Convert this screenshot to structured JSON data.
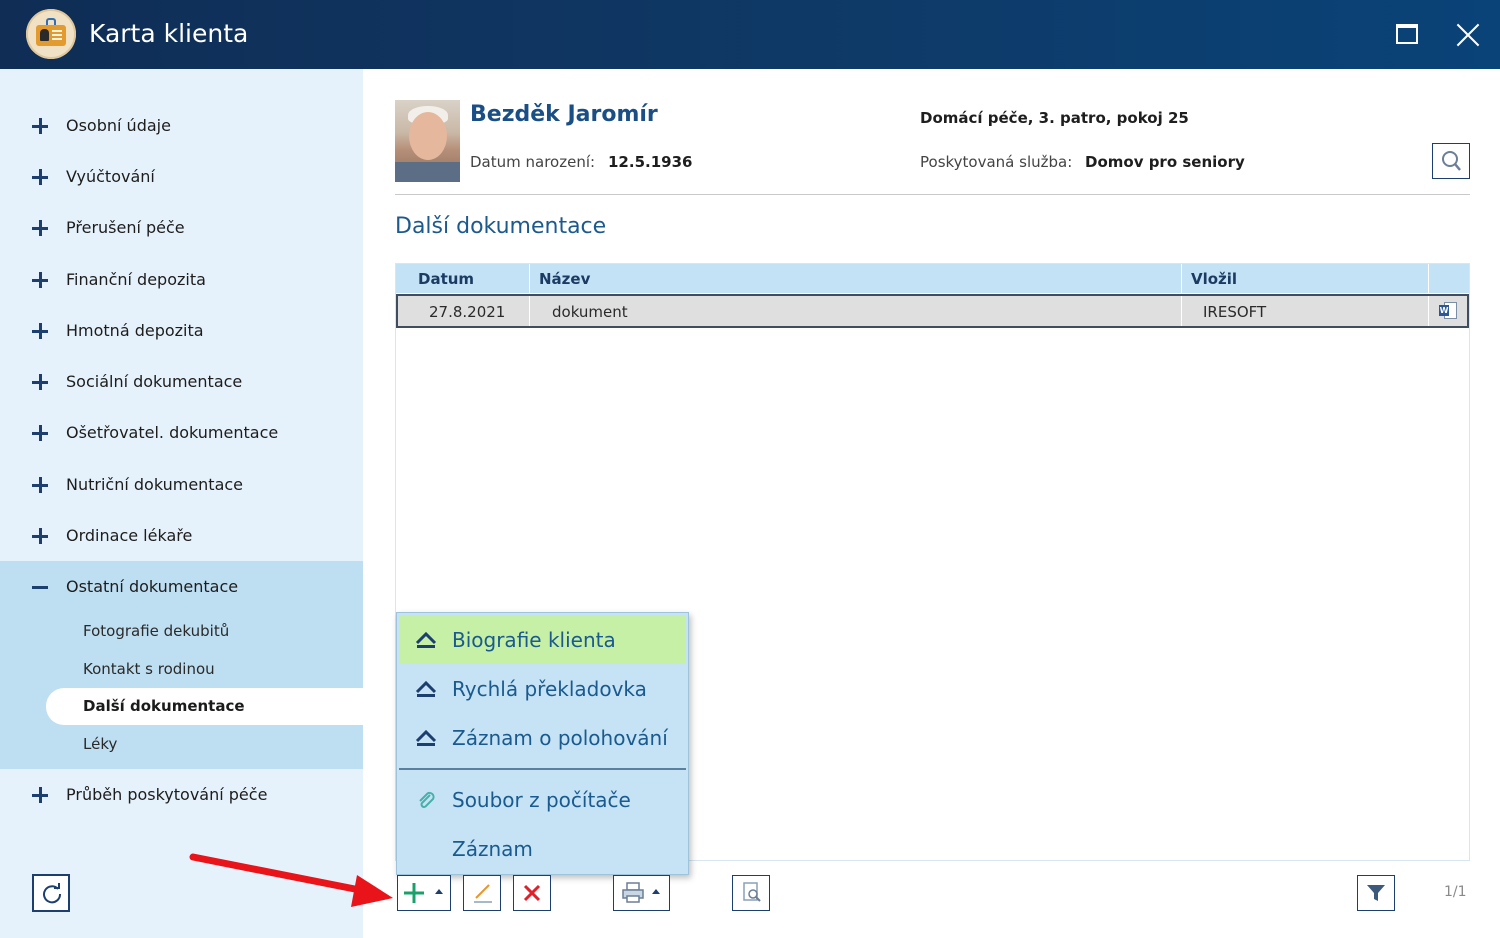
{
  "window": {
    "title": "Karta klienta"
  },
  "sidebar": {
    "items": [
      {
        "label": "Osobní údaje"
      },
      {
        "label": "Vyúčtování"
      },
      {
        "label": "Přerušení péče"
      },
      {
        "label": "Finanční depozita"
      },
      {
        "label": "Hmotná depozita"
      },
      {
        "label": "Sociální dokumentace"
      },
      {
        "label": "Ošetřovatel. dokumentace"
      },
      {
        "label": "Nutriční dokumentace"
      },
      {
        "label": "Ordinace lékaře"
      },
      {
        "label": "Ostatní dokumentace"
      },
      {
        "label": "Průběh poskytování péče"
      }
    ],
    "subitems": [
      {
        "label": "Fotografie dekubitů"
      },
      {
        "label": "Kontakt s rodinou"
      },
      {
        "label": "Další dokumentace"
      },
      {
        "label": "Léky"
      }
    ]
  },
  "client": {
    "name": "Bezděk Jaromír",
    "dob_label": "Datum narození:",
    "dob": "12.5.1936",
    "location": "Domácí péče, 3. patro, pokoj 25",
    "service_label": "Poskytovaná služba:",
    "service": "Domov pro seniory"
  },
  "section": {
    "title": "Další dokumentace"
  },
  "table": {
    "columns": [
      "Datum",
      "Název",
      "Vložil"
    ],
    "rows": [
      {
        "date": "27.8.2021",
        "name": "dokument",
        "author": "IRESOFT",
        "icon": "word-doc-icon"
      }
    ]
  },
  "menu": {
    "items": [
      {
        "label": "Biografie klienta",
        "icon": "form-icon"
      },
      {
        "label": "Rychlá překladovka",
        "icon": "form-icon"
      },
      {
        "label": "Záznam o polohování",
        "icon": "form-icon"
      },
      {
        "label": "Soubor z počítače",
        "icon": "paperclip-icon"
      },
      {
        "label": "Záznam",
        "icon": ""
      }
    ]
  },
  "pager": {
    "text": "1/1"
  },
  "colors": {
    "titlebar": "#0f3763",
    "sidebar": "#e6f2fb",
    "sidebar_group": "#bedef2",
    "accent_text": "#1a4f86",
    "menu_highlight": "#c6f0a6",
    "annotation_arrow": "#e8141a"
  }
}
